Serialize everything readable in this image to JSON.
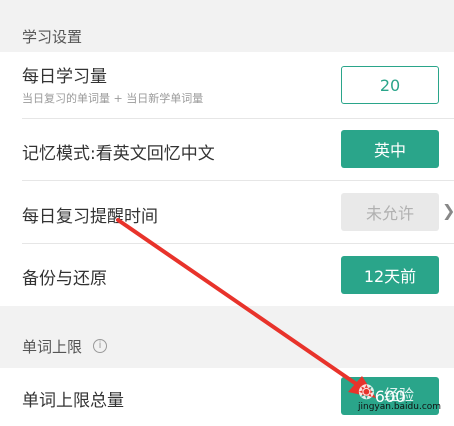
{
  "sections": {
    "study_settings": {
      "title": "学习设置"
    },
    "word_limit": {
      "title": "单词上限"
    }
  },
  "rows": {
    "daily_amount": {
      "label": "每日学习量",
      "sublabel": "当日复习的单词量 + 当日新学单词量",
      "value": "20"
    },
    "memory_mode": {
      "label": "记忆模式:看英文回忆中文",
      "button": "英中"
    },
    "review_reminder": {
      "label": "每日复习提醒时间",
      "button": "未允许"
    },
    "backup_restore": {
      "label": "备份与还原",
      "button": "12天前"
    },
    "word_limit_total": {
      "label": "单词上限总量",
      "button_visible": "600"
    }
  },
  "overlay": {
    "arrow_color": "#e8332b",
    "watermark_text": "经验",
    "watermark_url": "jingyan.baidu.com"
  },
  "colors": {
    "accent": "#2aa58a",
    "disabled": "#e9e9e9",
    "background": "#f2f2f2"
  }
}
